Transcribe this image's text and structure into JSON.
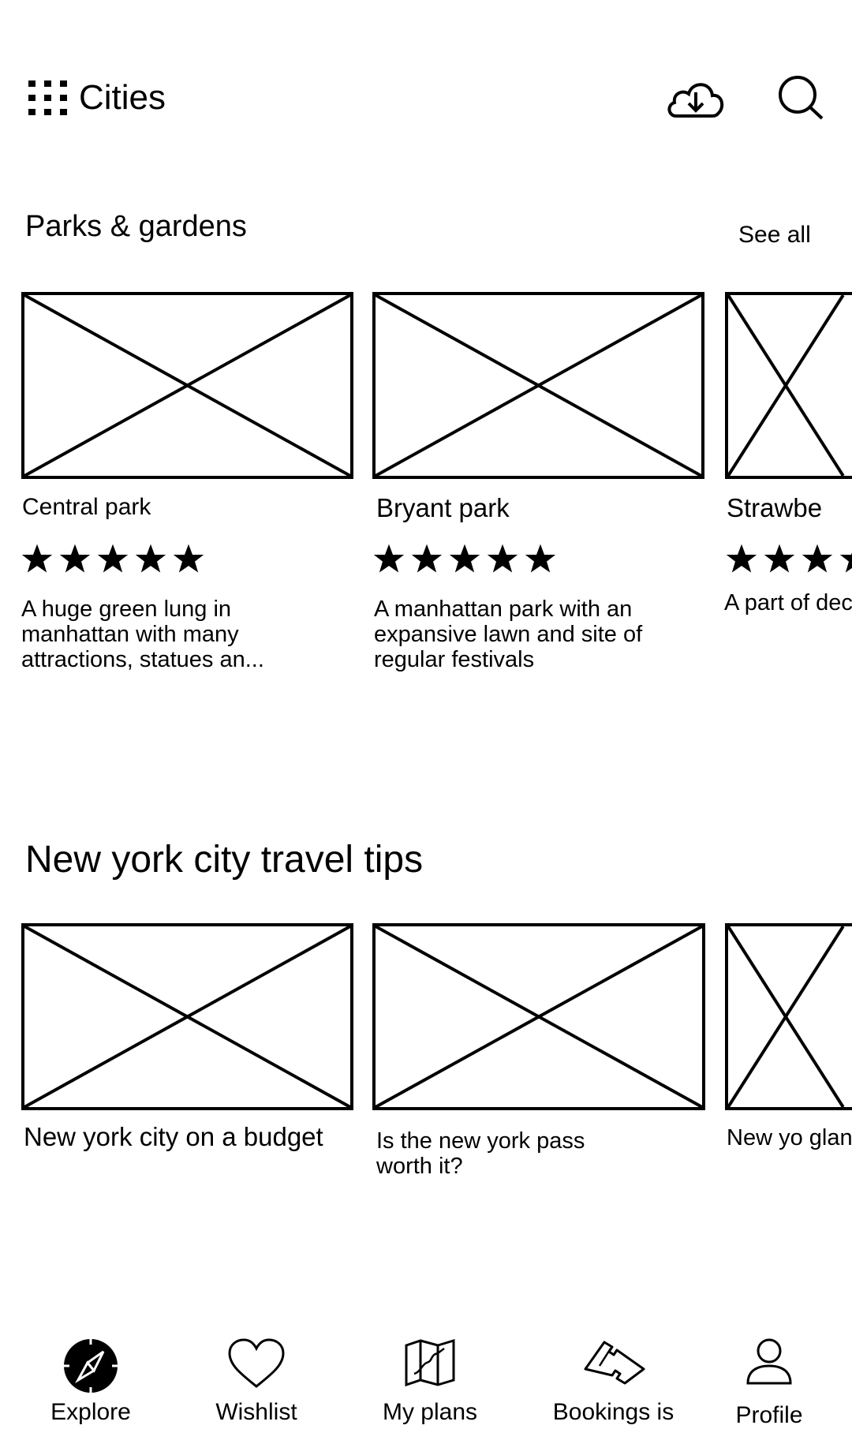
{
  "header": {
    "title": "Cities",
    "menu_icon": "grid-dots-icon",
    "download_icon": "cloud-download-icon",
    "search_icon": "search-icon"
  },
  "parks": {
    "title": "Parks & gardens",
    "see_all": "See all",
    "cards": [
      {
        "name": "Central park",
        "rating": 5,
        "description": "A huge green lung in manhattan with many attractions, statues an..."
      },
      {
        "name": "Bryant park",
        "rating": 5,
        "description": "A manhattan park with an expansive lawn and site of regular festivals"
      },
      {
        "name": "Strawbe",
        "rating": 4,
        "description": "A part of dec"
      }
    ]
  },
  "tips": {
    "title": "New york city travel tips",
    "cards": [
      {
        "title": "New york city on a budget"
      },
      {
        "title": "Is the new york pass worth it?"
      },
      {
        "title": "New yo glan"
      }
    ]
  },
  "nav": {
    "items": [
      {
        "label": "Explore",
        "icon": "compass-icon",
        "active": true
      },
      {
        "label": "Wishlist",
        "icon": "heart-icon",
        "active": false
      },
      {
        "label": "My plans",
        "icon": "map-icon",
        "active": false
      },
      {
        "label": "Bookings is",
        "icon": "ticket-icon",
        "active": false
      },
      {
        "label": "Profile",
        "icon": "person-icon",
        "active": false
      }
    ]
  }
}
